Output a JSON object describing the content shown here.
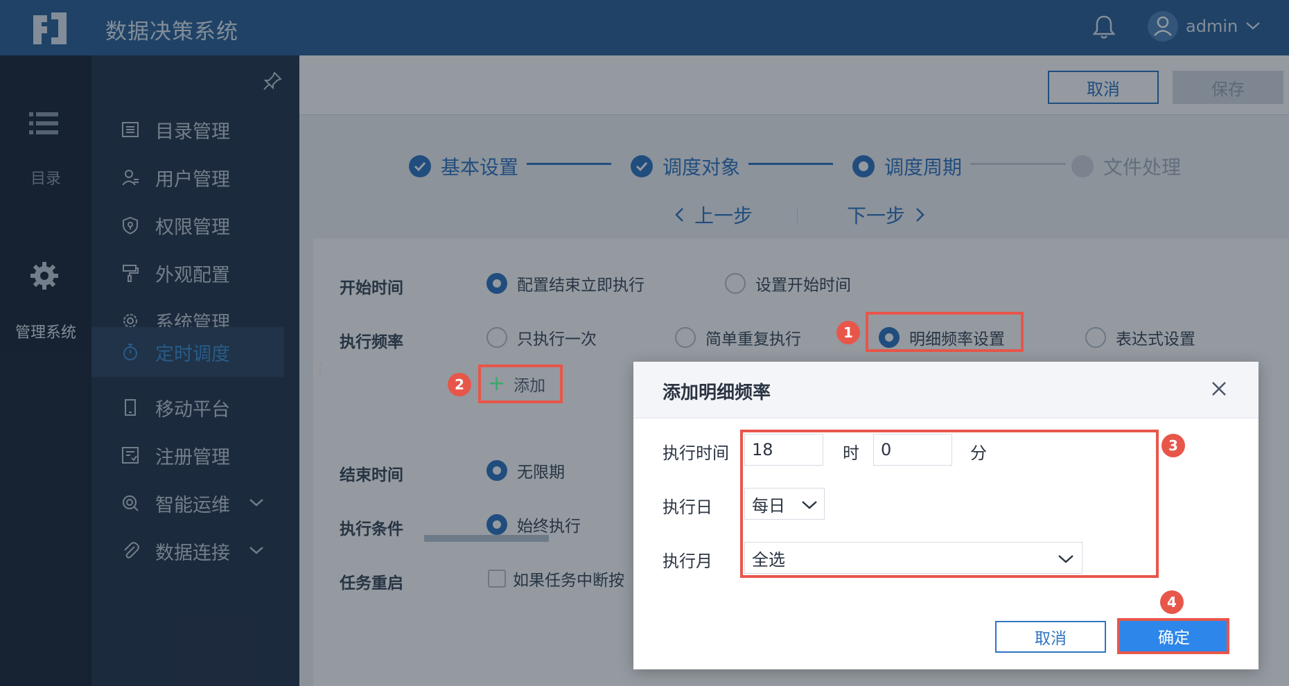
{
  "header": {
    "title": "数据决策系统",
    "user": "admin"
  },
  "leftbar": {
    "catalog_label": "目录",
    "admin_label": "管理系统"
  },
  "sidemenu": {
    "items": [
      {
        "label": "目录管理"
      },
      {
        "label": "用户管理"
      },
      {
        "label": "权限管理"
      },
      {
        "label": "外观配置"
      },
      {
        "label": "系统管理"
      },
      {
        "label": "定时调度"
      },
      {
        "label": "移动平台"
      },
      {
        "label": "注册管理"
      },
      {
        "label": "智能运维"
      },
      {
        "label": "数据连接"
      }
    ]
  },
  "toolbar": {
    "cancel_label": "取消",
    "save_label": "保存"
  },
  "steps": [
    "基本设置",
    "调度对象",
    "调度周期",
    "文件处理"
  ],
  "pager": {
    "prev": "上一步",
    "next": "下一步"
  },
  "form": {
    "start_time": {
      "label": "开始时间",
      "opt1": "配置结束立即执行",
      "opt2": "设置开始时间"
    },
    "frequency": {
      "label": "执行频率",
      "opt1": "只执行一次",
      "opt2": "简单重复执行",
      "opt3": "明细频率设置",
      "opt4": "表达式设置"
    },
    "add_label": "添加",
    "end_time": {
      "label": "结束时间",
      "opt1": "无限期"
    },
    "condition": {
      "label": "执行条件",
      "opt1": "始终执行"
    },
    "restart": {
      "label": "任务重启",
      "opt1": "如果任务中断按"
    }
  },
  "badges": [
    "1",
    "2",
    "3",
    "4"
  ],
  "dialog": {
    "title": "添加明细频率",
    "exec_time_label": "执行时间",
    "hour_value": "18",
    "hour_unit": "时",
    "minute_value": "0",
    "minute_unit": "分",
    "exec_day_label": "执行日",
    "exec_day_value": "每日",
    "exec_month_label": "执行月",
    "exec_month_value": "全选",
    "cancel_label": "取消",
    "ok_label": "确定"
  },
  "colors": {
    "primary": "#2f74c2",
    "header": "#2b5f95",
    "highlight": "#e8564a"
  }
}
